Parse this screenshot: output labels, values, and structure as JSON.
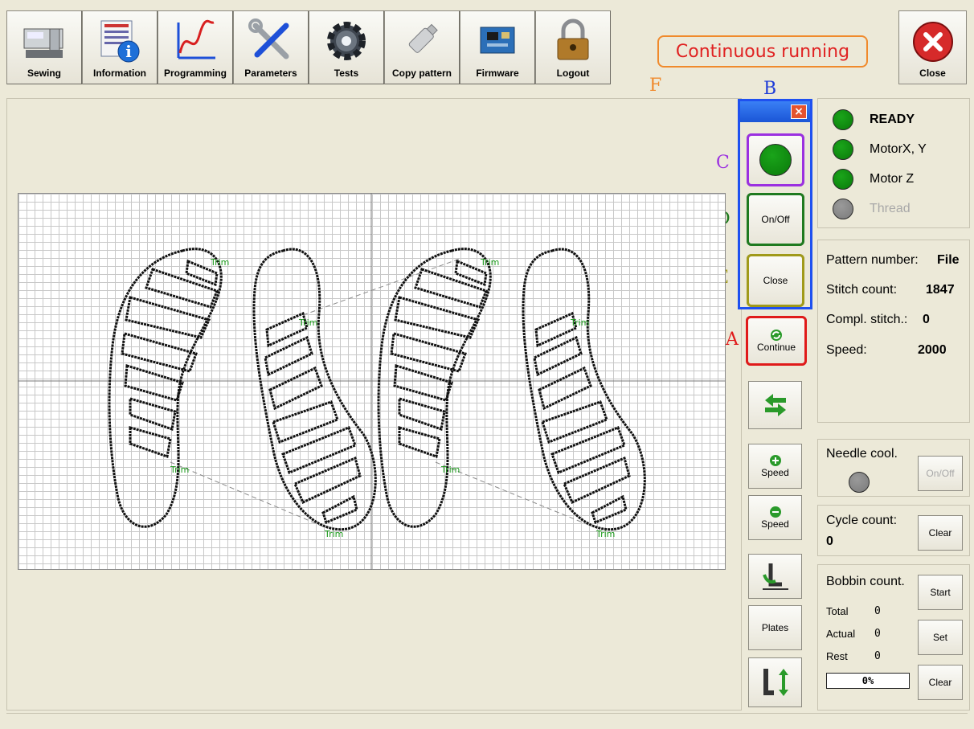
{
  "toolbar": {
    "items": [
      {
        "label": "Sewing",
        "icon": "sewing-machine-icon"
      },
      {
        "label": "Information",
        "icon": "info-icon"
      },
      {
        "label": "Programming",
        "icon": "graph-icon"
      },
      {
        "label": "Parameters",
        "icon": "tools-icon"
      },
      {
        "label": "Tests",
        "icon": "gear-icon"
      },
      {
        "label": "Copy pattern",
        "icon": "usb-stick-icon"
      },
      {
        "label": "Firmware",
        "icon": "chip-board-icon"
      },
      {
        "label": "Logout",
        "icon": "padlock-icon"
      }
    ]
  },
  "status_banner": "Continuous running",
  "close_label": "Close",
  "annotations": {
    "a": "A",
    "b": "B",
    "c": "C",
    "d": "D",
    "e": "E",
    "f": "F"
  },
  "floating_panel": {
    "onoff_label": "On/Off",
    "close_label": "Close"
  },
  "side": {
    "continue_label": "Continue",
    "speed_up_label": "Speed",
    "speed_down_label": "Speed",
    "plates_label": "Plates"
  },
  "status": {
    "ready": "READY",
    "motor_xy": "MotorX, Y",
    "motor_z": "Motor Z",
    "thread": "Thread"
  },
  "info": {
    "pattern_number_label": "Pattern number:",
    "pattern_number_value": "File",
    "stitch_count_label": "Stitch count:",
    "stitch_count_value": "1847",
    "compl_stitch_label": "Compl. stitch.:",
    "compl_stitch_value": "0",
    "speed_label": "Speed:",
    "speed_value": "2000"
  },
  "needle": {
    "label": "Needle cool.",
    "button": "On/Off"
  },
  "cycle": {
    "label": "Cycle count:",
    "value": "0",
    "button": "Clear"
  },
  "bobbin": {
    "label": "Bobbin count.",
    "total_label": "Total",
    "total_value": "0",
    "actual_label": "Actual",
    "actual_value": "0",
    "rest_label": "Rest",
    "rest_value": "0",
    "progress_text": "0%",
    "progress": 0,
    "start_button": "Start",
    "set_button": "Set",
    "clear_button": "Clear"
  },
  "pattern": {
    "trim_label": "Trim"
  },
  "colors": {
    "status_red": "#e02222",
    "highlight_orange": "#f08a2c",
    "ok_green": "#0a7a0a"
  }
}
